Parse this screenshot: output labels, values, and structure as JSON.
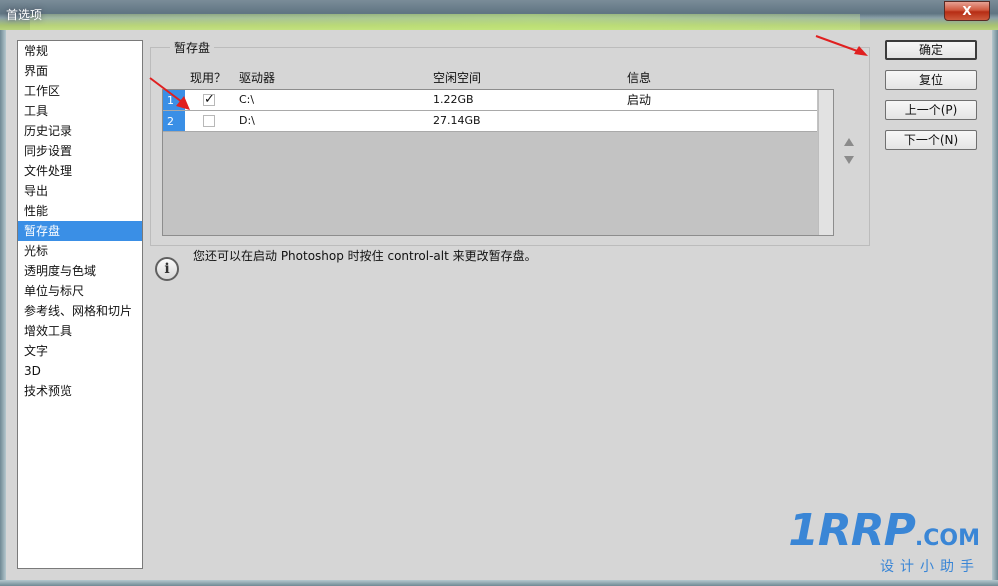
{
  "window": {
    "title": "首选项",
    "close_glyph": "X"
  },
  "sidebar": {
    "items": [
      {
        "label": "常规"
      },
      {
        "label": "界面"
      },
      {
        "label": "工作区"
      },
      {
        "label": "工具"
      },
      {
        "label": "历史记录"
      },
      {
        "label": "同步设置"
      },
      {
        "label": "文件处理"
      },
      {
        "label": "导出"
      },
      {
        "label": "性能"
      },
      {
        "label": "暂存盘"
      },
      {
        "label": "光标"
      },
      {
        "label": "透明度与色域"
      },
      {
        "label": "单位与标尺"
      },
      {
        "label": "参考线、网格和切片"
      },
      {
        "label": "增效工具"
      },
      {
        "label": "文字"
      },
      {
        "label": "3D"
      },
      {
        "label": "技术预览"
      }
    ],
    "selected": "暂存盘"
  },
  "scratch": {
    "group_title": "暂存盘",
    "columns": {
      "active": "现用？",
      "drive": "驱动器",
      "free": "空闲空间",
      "info": "信息"
    },
    "rows": [
      {
        "num": "1",
        "checked": true,
        "check_glyph": "✓",
        "drive": "C:\\",
        "free": "1.22GB",
        "info": "启动"
      },
      {
        "num": "2",
        "checked": false,
        "check_glyph": "",
        "drive": "D:\\",
        "free": "27.14GB",
        "info": ""
      }
    ]
  },
  "info": {
    "icon": "i",
    "text": "您还可以在启动 Photoshop 时按住 control-alt 来更改暂存盘。"
  },
  "buttons": {
    "ok": "确定",
    "reset": "复位",
    "prev": "上一个(P)",
    "next": "下一个(N)"
  },
  "watermark": {
    "brand": "1RRP",
    "suffix": ".COM",
    "tagline": "设计小助手"
  },
  "colors": {
    "selection": "#3a8fe6",
    "annotation_arrow": "#e02020",
    "watermark": "#3a86d6"
  }
}
